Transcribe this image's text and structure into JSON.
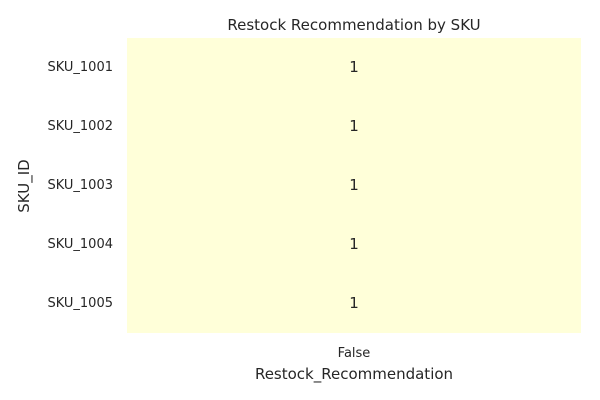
{
  "chart_data": {
    "type": "heatmap",
    "title": "Restock Recommendation by SKU",
    "xlabel": "Restock_Recommendation",
    "ylabel": "SKU_ID",
    "x_categories": [
      "False"
    ],
    "y_categories": [
      "SKU_1001",
      "SKU_1002",
      "SKU_1003",
      "SKU_1004",
      "SKU_1005"
    ],
    "values": [
      [
        1
      ],
      [
        1
      ],
      [
        1
      ],
      [
        1
      ],
      [
        1
      ]
    ],
    "annotations": true,
    "colorbar": false,
    "colors": {
      "cell_fill": "#ffffd9",
      "text": "#262626",
      "background": "#ffffff"
    }
  }
}
